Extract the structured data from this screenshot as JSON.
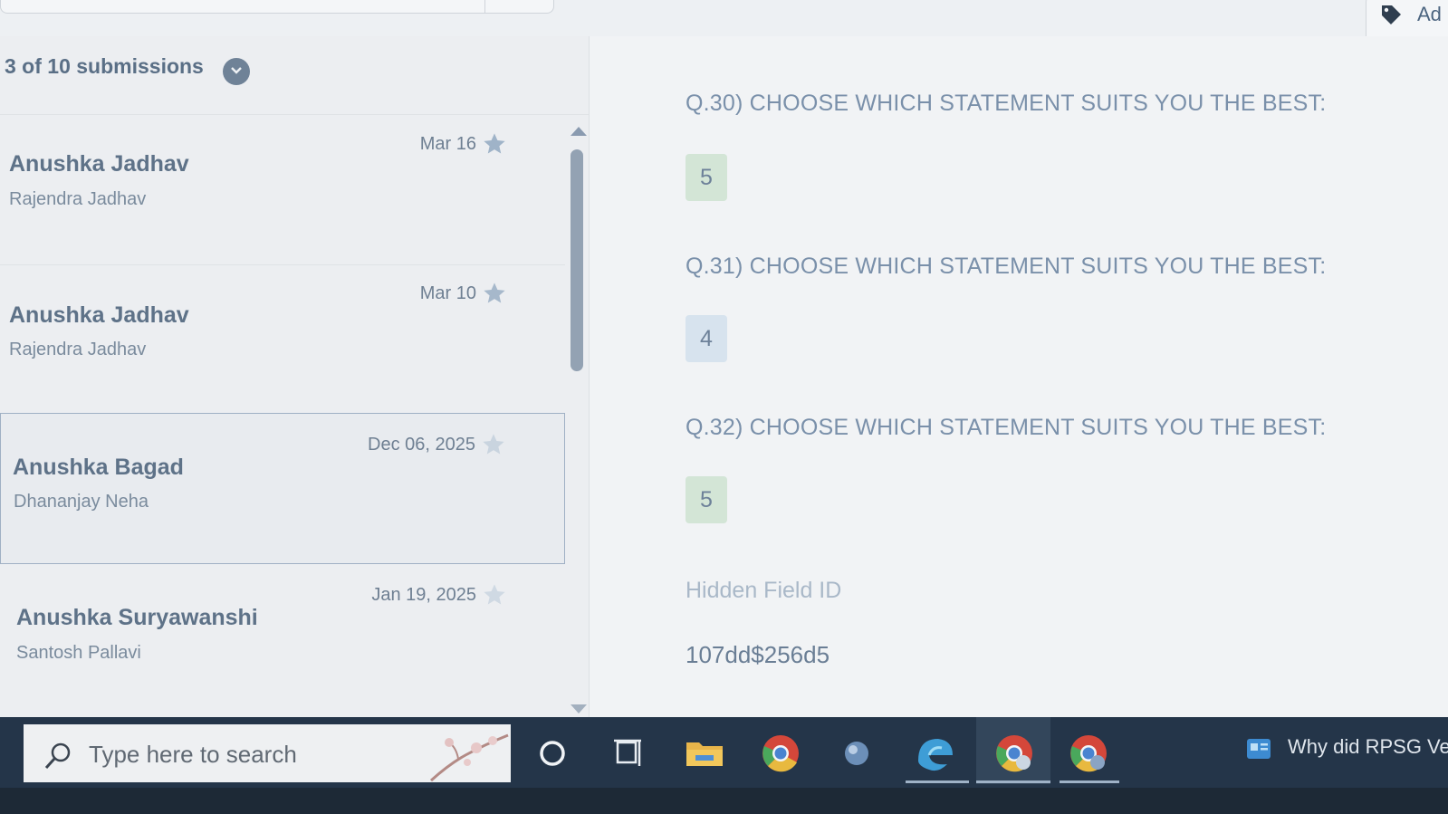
{
  "topbar": {
    "add_label": "Ad"
  },
  "submissions": {
    "count_label": "3 of 10 submissions",
    "items": [
      {
        "date": "Mar 16",
        "name": "Anushka Jadhav",
        "sub": "Rajendra Jadhav",
        "starred": true
      },
      {
        "date": "Mar 10",
        "name": "Anushka Jadhav",
        "sub": "Rajendra Jadhav",
        "starred": true
      },
      {
        "date": "Dec 06, 2025",
        "name": "Anushka Bagad",
        "sub": "Dhananjay Neha",
        "starred": false,
        "selected": true
      },
      {
        "date": "Jan 19, 2025",
        "name": "Anushka Suryawanshi",
        "sub": "Santosh Pallavi",
        "starred": false
      }
    ]
  },
  "detail": {
    "questions": [
      {
        "label": "Q.30) CHOOSE WHICH STATEMENT SUITS YOU THE BEST:",
        "answer": "5"
      },
      {
        "label": "Q.31) CHOOSE WHICH STATEMENT SUITS YOU THE BEST:",
        "answer": "4"
      },
      {
        "label": "Q.32) CHOOSE WHICH STATEMENT SUITS YOU THE BEST:",
        "answer": "5"
      }
    ],
    "hidden_field_label": "Hidden Field ID",
    "hidden_field_value": "107dd$256d5"
  },
  "taskbar": {
    "search_placeholder": "Type here to search",
    "icons": [
      "cortana-icon",
      "task-view-icon",
      "file-explorer-icon",
      "chrome-icon",
      "app-orb-icon",
      "edge-icon",
      "chrome-profile-icon",
      "chrome-profile2-icon"
    ],
    "news_text": "Why did RPSG Ver"
  },
  "colors": {
    "accent": "#7a90aa",
    "green_answer": "#d3e5d6",
    "blue_answer": "#d7e3ee",
    "taskbar": "#243549"
  }
}
